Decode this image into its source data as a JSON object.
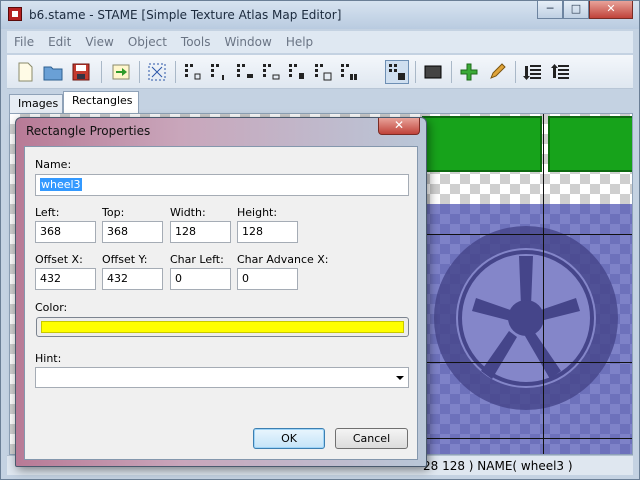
{
  "window": {
    "title": "b6.stame - STAME [Simple Texture Atlas Map Editor]"
  },
  "menu": [
    "File",
    "Edit",
    "View",
    "Object",
    "Tools",
    "Window",
    "Help"
  ],
  "tabs": {
    "images": "Images",
    "rectangles": "Rectangles"
  },
  "status": {
    "text": "28 128 ) NAME( wheel3 )"
  },
  "dialog": {
    "title": "Rectangle Properties",
    "name_label": "Name:",
    "name_value": "wheel3",
    "left_label": "Left:",
    "left_value": "368",
    "top_label": "Top:",
    "top_value": "368",
    "width_label": "Width:",
    "width_value": "128",
    "height_label": "Height:",
    "height_value": "128",
    "offsetx_label": "Offset X:",
    "offsetx_value": "432",
    "offsety_label": "Offset Y:",
    "offsety_value": "432",
    "charleft_label": "Char Left:",
    "charleft_value": "0",
    "charadvance_label": "Char Advance X:",
    "charadvance_value": "0",
    "color_label": "Color:",
    "color_value": "#ffff00",
    "hint_label": "Hint:",
    "hint_value": "",
    "ok_label": "OK",
    "cancel_label": "Cancel"
  },
  "icons": {
    "app": "stame-app-icon",
    "new": "new-file-icon",
    "open": "open-folder-icon",
    "save": "save-disk-icon",
    "export": "export-arrow-icon",
    "fit": "fit-view-icon",
    "add": "add-plus-icon",
    "edit": "pencil-icon",
    "sort": "sort-list-icon",
    "sort_desc": "sort-list-descending-icon"
  }
}
